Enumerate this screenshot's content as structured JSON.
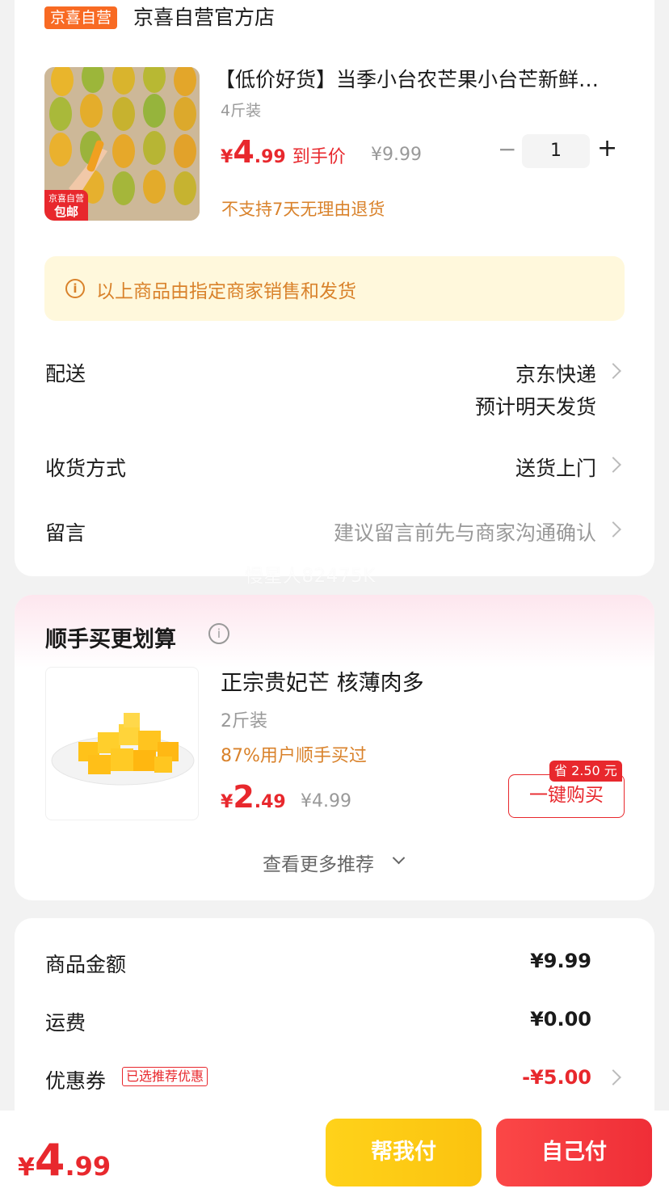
{
  "store": {
    "badge": "京喜自营",
    "name": "京喜自营官方店"
  },
  "product": {
    "title": "【低价好货】当季小台农芒果小台芒新鲜…",
    "spec": "4斤装",
    "price_currency": "¥",
    "price_int": "4",
    "price_dec": ".99",
    "price_label": "到手价",
    "original_price": "¥9.99",
    "quantity": "1",
    "minus": "−",
    "plus": "+",
    "return_note": "不支持7天无理由退货",
    "image_tag_top": "京喜自营",
    "image_tag_bottom": "包邮"
  },
  "notice": {
    "text": "以上商品由指定商家销售和发货",
    "icon": "i"
  },
  "rows": {
    "delivery_label": "配送",
    "delivery_value1": "京东快递",
    "delivery_value2": "预计明天发货",
    "receive_label": "收货方式",
    "receive_value": "送货上门",
    "message_label": "留言",
    "message_placeholder": "建议留言前先与商家沟通确认"
  },
  "watermark": "慢星人82475K",
  "recommend": {
    "title": "顺手买更划算",
    "info_icon": "i",
    "name": "正宗贵妃芒 核薄肉多",
    "spec": "2斤装",
    "social": "87%用户顺手买过",
    "price_currency": "¥",
    "price_int": "2",
    "price_dec": ".49",
    "original_price": "¥4.99",
    "save_badge": "省 2.50 元",
    "buy_button": "一键购买",
    "more": "查看更多推荐"
  },
  "summary": {
    "goods_label": "商品金额",
    "goods_value": "¥9.99",
    "shipping_label": "运费",
    "shipping_value": "¥0.00",
    "coupon_label": "优惠券",
    "coupon_tag": "已选推荐优惠",
    "coupon_value": "-¥5.00"
  },
  "bottom": {
    "total_currency": "¥",
    "total_int": "4",
    "total_dec": ".99",
    "help_pay": "帮我付",
    "self_pay": "自己付"
  },
  "colors": {
    "accent_red": "#e8282d",
    "orange": "#d9822b",
    "yellow_button": "#fbc30f",
    "store_badge": "#f86a23"
  }
}
